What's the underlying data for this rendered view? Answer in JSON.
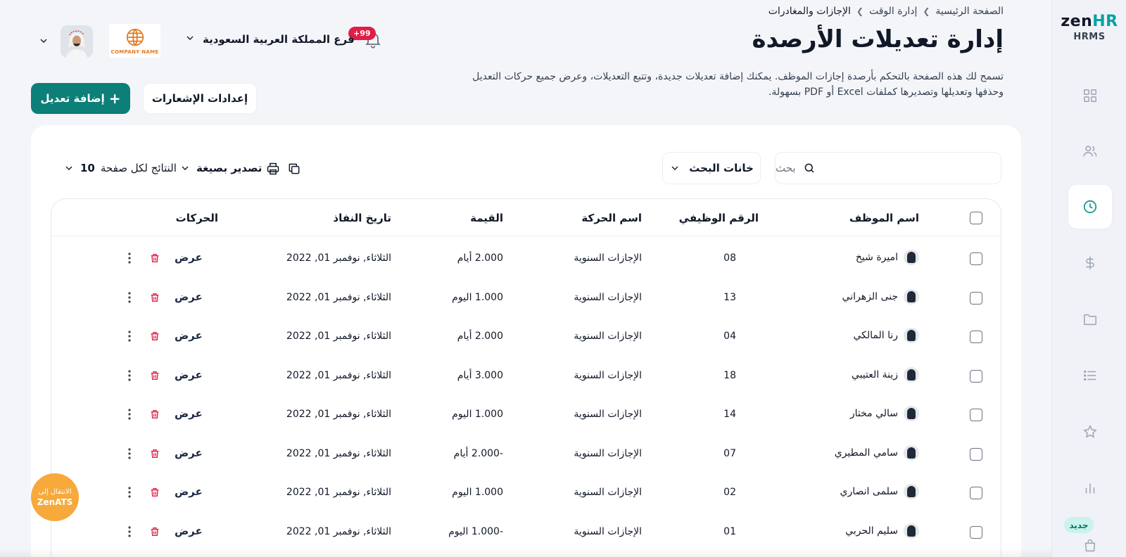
{
  "app": {
    "logo_zen": "zen",
    "logo_hr": "HR",
    "logo_sub": "HRMS",
    "new_badge": "جديد"
  },
  "breadcrumb": [
    "الصفحة الرئيسية",
    "إدارة الوقت",
    "الإجازات والمغادرات"
  ],
  "page": {
    "title": "إدارة تعديلات الأرصدة",
    "description": "تسمح لك هذه الصفحة بالتحكم بأرصدة إجازات الموظف. يمكنك إضافة تعديلات جديدة، وتتبع التعديلات، وعرض جميع حركات التعديل وحذفها وتعديلها وتصديرها كملفات Excel أو PDF بسهولة."
  },
  "header": {
    "notification_count": "+99",
    "branch": "فرع المملكة العربية السعودية",
    "company_name": "COMPANY NAME"
  },
  "actions": {
    "add_label": "إضافة تعديل",
    "add_plus": "+",
    "notify_settings": "إعدادات الإشعارات"
  },
  "toolbar": {
    "search_placeholder": "بحث",
    "search_fields": "خانات البحث",
    "export_label": "تصدير بصيغة",
    "per_page_label": "النتائج لكل صفحة",
    "per_page_value": "10"
  },
  "table": {
    "columns": [
      "اسم الموظف",
      "الرقم الوظيفي",
      "اسم الحركة",
      "القيمة",
      "تاريخ النفاذ",
      "الحركات"
    ],
    "view_label": "عرض",
    "rows": [
      {
        "name": "اميرة شيخ",
        "id": "08",
        "movement": "الإجازات السنوية",
        "value": "2.000 أيام",
        "date": "الثلاثاء, نوفمبر 01, 2022"
      },
      {
        "name": "جنى الزهراني",
        "id": "13",
        "movement": "الإجازات السنوية",
        "value": "1.000 اليوم",
        "date": "الثلاثاء, نوفمبر 01, 2022"
      },
      {
        "name": "رنا المالكي",
        "id": "04",
        "movement": "الإجازات السنوية",
        "value": "2.000 أيام",
        "date": "الثلاثاء, نوفمبر 01, 2022"
      },
      {
        "name": "زينة العتيبي",
        "id": "18",
        "movement": "الإجازات السنوية",
        "value": "3.000 أيام",
        "date": "الثلاثاء, نوفمبر 01, 2022"
      },
      {
        "name": "سالي مختار",
        "id": "14",
        "movement": "الإجازات السنوية",
        "value": "1.000 اليوم",
        "date": "الثلاثاء, نوفمبر 01, 2022"
      },
      {
        "name": "سامي المطيري",
        "id": "07",
        "movement": "الإجازات السنوية",
        "value": "-2.000 أيام",
        "date": "الثلاثاء, نوفمبر 01, 2022"
      },
      {
        "name": "سلمى انصاري",
        "id": "02",
        "movement": "الإجازات السنوية",
        "value": "1.000 اليوم",
        "date": "الثلاثاء, نوفمبر 01, 2022"
      },
      {
        "name": "سليم الحربي",
        "id": "01",
        "movement": "الإجازات السنوية",
        "value": "-1.000 اليوم",
        "date": "الثلاثاء, نوفمبر 01, 2022"
      }
    ]
  },
  "floating": {
    "zenats_line1": "الانتقال إلى",
    "zenats_line2": "ZenATS"
  },
  "colors": {
    "primary": "#0b7f78",
    "accent_logo": "#00a3a3",
    "danger": "#e11d48",
    "badge": "#e11d48",
    "zenats": "#f7a93b"
  },
  "icons": {
    "sidebar": [
      "dashboard-icon",
      "users-icon",
      "clock-icon",
      "dollar-icon",
      "folder-icon",
      "list-icon",
      "star-icon",
      "chart-icon",
      "bag-icon"
    ]
  }
}
